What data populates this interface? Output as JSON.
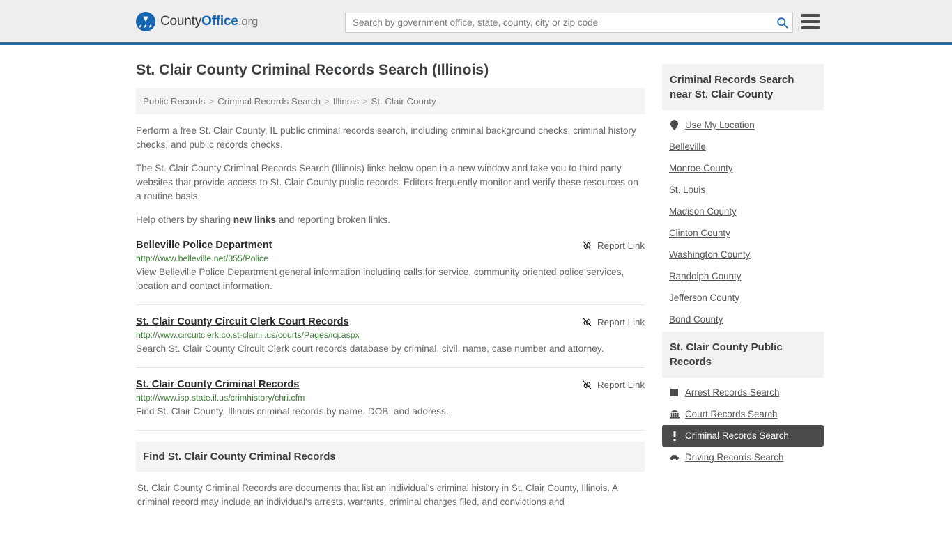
{
  "header": {
    "logo": {
      "county": "County",
      "office": "Office",
      "org": ".org",
      "eagle_glyph": "▼",
      "stars_glyph": "★★★"
    },
    "search": {
      "placeholder": "Search by government office, state, county, city or zip code",
      "value": "",
      "button_label": "Search"
    },
    "menu_label": "Menu",
    "accent_color": "#2b6ca3"
  },
  "main": {
    "page_title": "St. Clair County Criminal Records Search (Illinois)",
    "breadcrumb": [
      {
        "label": "Public Records"
      },
      {
        "label": "Criminal Records Search"
      },
      {
        "label": "Illinois"
      },
      {
        "label": "St. Clair County"
      }
    ],
    "breadcrumb_separator": ">",
    "paragraphs": {
      "p1": "Perform a free St. Clair County, IL public criminal records search, including criminal background checks, criminal history checks, and public records checks.",
      "p2": "The St. Clair County Criminal Records Search (Illinois) links below open in a new window and take you to third party websites that provide access to St. Clair County public records. Editors frequently monitor and verify these resources on a routine basis.",
      "p3_before": "Help others by sharing ",
      "p3_link": "new links",
      "p3_after": " and reporting broken links."
    },
    "report_link_label": "Report Link",
    "results": [
      {
        "title": "Belleville Police Department",
        "url": "http://www.belleville.net/355/Police",
        "description": "View Belleville Police Department general information including calls for service, community oriented police services, location and contact information."
      },
      {
        "title": "St. Clair County Circuit Clerk Court Records",
        "url": "http://www.circuitclerk.co.st-clair.il.us/courts/Pages/icj.aspx",
        "description": "Search St. Clair County Circuit Clerk court records database by criminal, civil, name, case number and attorney."
      },
      {
        "title": "St. Clair County Criminal Records",
        "url": "http://www.isp.state.il.us/crimhistory/chri.cfm",
        "description": "Find St. Clair County, Illinois criminal records by name, DOB, and address."
      }
    ],
    "info_block": {
      "heading": "Find St. Clair County Criminal Records",
      "body": "St. Clair County Criminal Records are documents that list an individual's criminal history in St. Clair County, Illinois. A criminal record may include an individual's arrests, warrants, criminal charges filed, and convictions and"
    }
  },
  "sidebar": {
    "nearby": {
      "heading": "Criminal Records Search near St. Clair County",
      "items": [
        {
          "label": "Use My Location",
          "icon": "map-pin-icon"
        },
        {
          "label": "Belleville",
          "icon": ""
        },
        {
          "label": "Monroe County",
          "icon": ""
        },
        {
          "label": "St. Louis",
          "icon": ""
        },
        {
          "label": "Madison County",
          "icon": ""
        },
        {
          "label": "Clinton County",
          "icon": ""
        },
        {
          "label": "Washington County",
          "icon": ""
        },
        {
          "label": "Randolph County",
          "icon": ""
        },
        {
          "label": "Jefferson County",
          "icon": ""
        },
        {
          "label": "Bond County",
          "icon": ""
        }
      ]
    },
    "public_records": {
      "heading": "St. Clair County Public Records",
      "items": [
        {
          "label": "Arrest Records Search",
          "icon": "square-icon",
          "active": false
        },
        {
          "label": "Court Records Search",
          "icon": "courthouse-icon",
          "active": false
        },
        {
          "label": "Criminal Records Search",
          "icon": "exclamation-icon",
          "active": true
        },
        {
          "label": "Driving Records Search",
          "icon": "car-icon",
          "active": false
        }
      ]
    }
  }
}
